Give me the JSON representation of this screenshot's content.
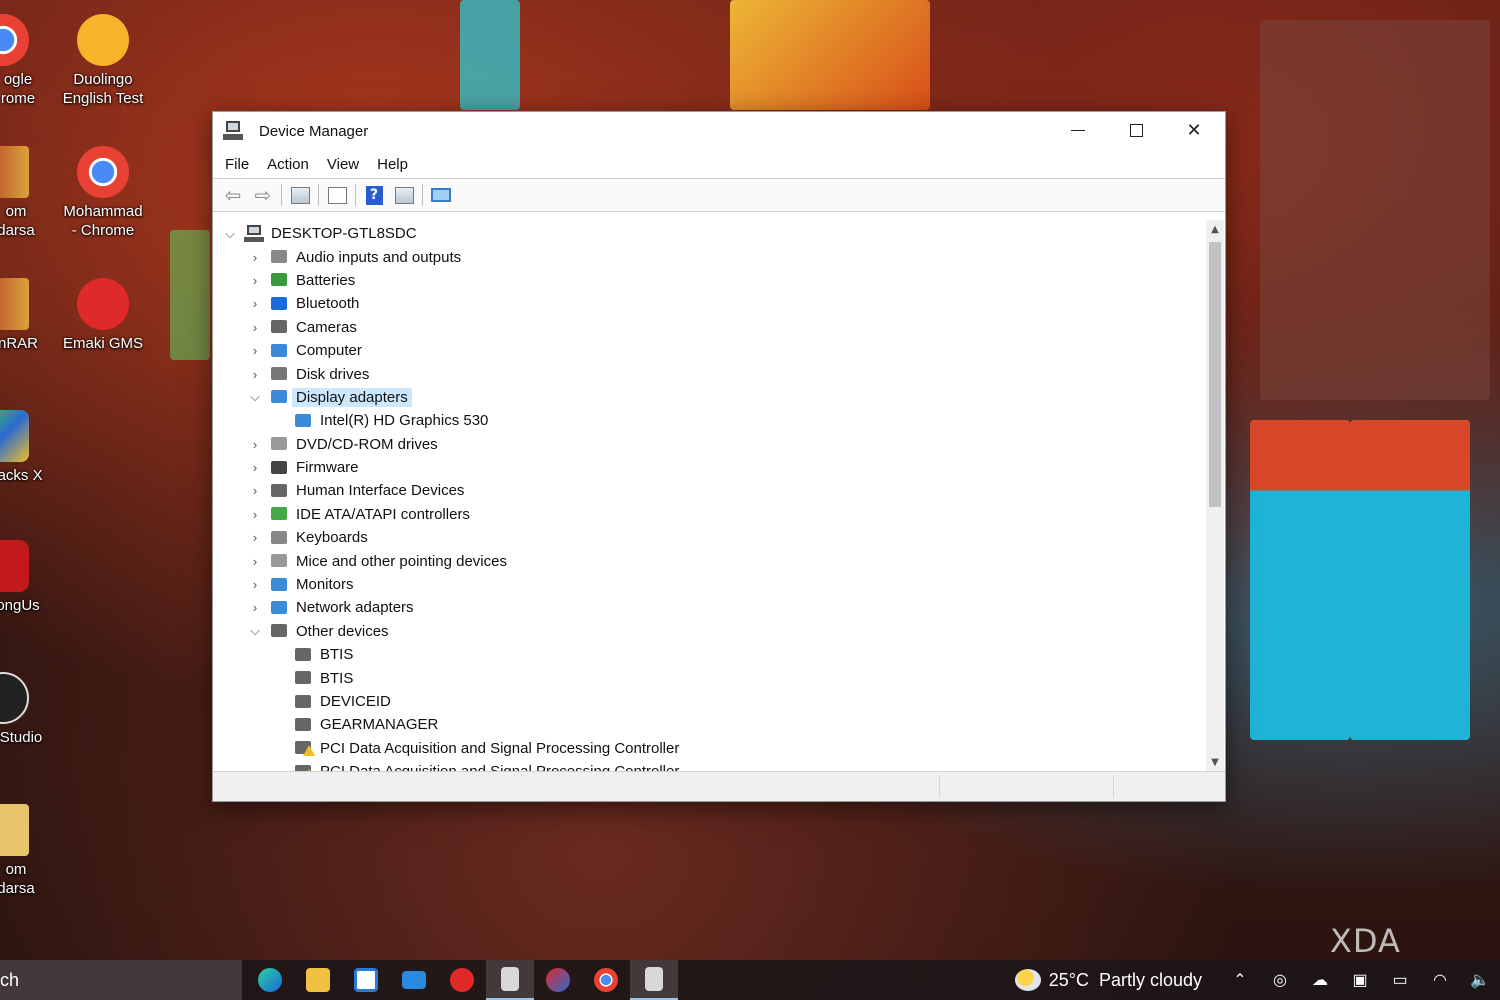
{
  "desktop": {
    "icons": [
      {
        "label": "ogle\nrome",
        "x_hint": "left"
      },
      {
        "label": "Duolingo English Test"
      },
      {
        "label": "om\ndarsa"
      },
      {
        "label": "Mohammad - Chrome"
      },
      {
        "label": "nRAR"
      },
      {
        "label": "Emaki GMS"
      },
      {
        "label": "tacks X"
      },
      {
        "label": "ongUs"
      },
      {
        "label": "Studio"
      },
      {
        "label": "om\ndarsa"
      }
    ],
    "watermark": "XDA"
  },
  "window": {
    "title": "Device Manager",
    "menu": [
      "File",
      "Action",
      "View",
      "Help"
    ],
    "toolbar": {
      "back": "back-icon",
      "forward": "forward-icon",
      "properties": "properties-icon",
      "update": "update-driver-icon",
      "help": "?",
      "action": "action-icon",
      "scan": "scan-hardware-icon"
    },
    "tree": {
      "root": "DESKTOP-GTL8SDC",
      "items": [
        {
          "label": "Audio inputs and outputs",
          "icon": "speaker-icon",
          "expanded": false
        },
        {
          "label": "Batteries",
          "icon": "battery-icon",
          "expanded": false
        },
        {
          "label": "Bluetooth",
          "icon": "bluetooth-icon",
          "expanded": false
        },
        {
          "label": "Cameras",
          "icon": "camera-icon",
          "expanded": false
        },
        {
          "label": "Computer",
          "icon": "computer-icon",
          "expanded": false
        },
        {
          "label": "Disk drives",
          "icon": "disk-icon",
          "expanded": false
        },
        {
          "label": "Display adapters",
          "icon": "display-adapter-icon",
          "expanded": true,
          "selected": true,
          "children": [
            "Intel(R) HD Graphics 530"
          ]
        },
        {
          "label": "DVD/CD-ROM drives",
          "icon": "dvd-icon",
          "expanded": false
        },
        {
          "label": "Firmware",
          "icon": "firmware-icon",
          "expanded": false
        },
        {
          "label": "Human Interface Devices",
          "icon": "hid-icon",
          "expanded": false
        },
        {
          "label": "IDE ATA/ATAPI controllers",
          "icon": "ide-icon",
          "expanded": false
        },
        {
          "label": "Keyboards",
          "icon": "keyboard-icon",
          "expanded": false
        },
        {
          "label": "Mice and other pointing devices",
          "icon": "mouse-icon",
          "expanded": false
        },
        {
          "label": "Monitors",
          "icon": "monitor-icon",
          "expanded": false
        },
        {
          "label": "Network adapters",
          "icon": "network-icon",
          "expanded": false
        },
        {
          "label": "Other devices",
          "icon": "unknown-device-icon",
          "expanded": true,
          "children": [
            "BTIS",
            "BTIS",
            "DEVICEID",
            "GEARMANAGER",
            "PCI Data Acquisition and Signal Processing Controller",
            "PCI Data Acquisition and Signal Processing Controller"
          ]
        }
      ]
    }
  },
  "taskbar": {
    "search_text": "ch",
    "weather": {
      "temp": "25°C",
      "condition": "Partly cloudy"
    },
    "colors": {
      "accent": "#9cc4e8",
      "selection": "#cce8ff"
    }
  }
}
